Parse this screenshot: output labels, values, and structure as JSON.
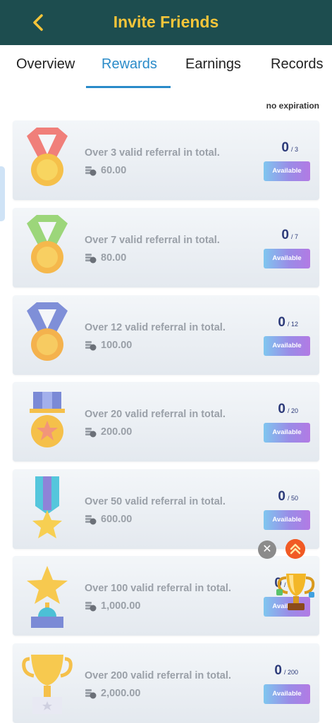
{
  "header": {
    "title": "Invite Friends"
  },
  "tabs": [
    {
      "label": "Overview"
    },
    {
      "label": "Rewards"
    },
    {
      "label": "Earnings"
    },
    {
      "label": "Records"
    }
  ],
  "active_tab": "Rewards",
  "expiry_note": "no expiration",
  "rewards": [
    {
      "text": "Over 3 valid referral in total.",
      "amount": "60.00",
      "current": "0",
      "total": "/ 3",
      "button": "Available",
      "medal": "red-ribbon-medal-icon"
    },
    {
      "text": "Over 7 valid referral in total.",
      "amount": "80.00",
      "current": "0",
      "total": "/ 7",
      "button": "Available",
      "medal": "green-ribbon-medal-icon"
    },
    {
      "text": "Over 12 valid referral in total.",
      "amount": "100.00",
      "current": "0",
      "total": "/ 12",
      "button": "Available",
      "medal": "blue-ribbon-medal-icon"
    },
    {
      "text": "Over 20 valid referral in total.",
      "amount": "200.00",
      "current": "0",
      "total": "/ 20",
      "button": "Available",
      "medal": "star-medal-icon"
    },
    {
      "text": "Over 50 valid referral in total.",
      "amount": "600.00",
      "current": "0",
      "total": "/ 50",
      "button": "Available",
      "medal": "star-ribbon-icon"
    },
    {
      "text": "Over 100 valid referral in total.",
      "amount": "1,000.00",
      "current": "0",
      "total": "/ 100",
      "button": "Available",
      "medal": "star-trophy-icon"
    },
    {
      "text": "Over 200 valid referral in total.",
      "amount": "2,000.00",
      "current": "0",
      "total": "/ 200",
      "button": "Available",
      "medal": "cup-trophy-icon"
    }
  ],
  "colors": {
    "header_bg": "#1d4d4f",
    "title": "#f5c53a",
    "tab_active": "#2a8bc9",
    "progress": "#2c3a79"
  }
}
